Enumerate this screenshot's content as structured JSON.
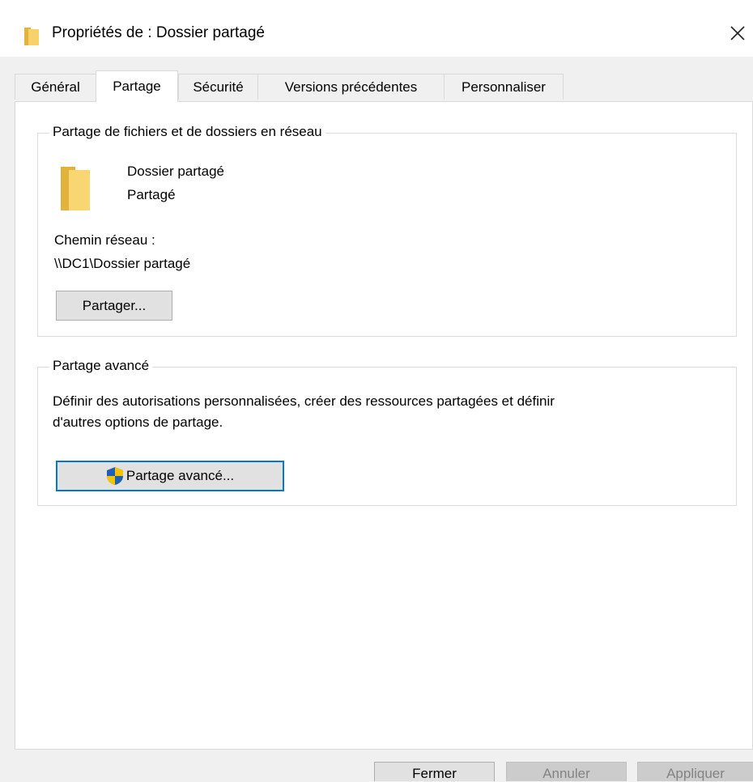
{
  "window": {
    "title": "Propriétés de : Dossier partagé",
    "close_glyph": "✕"
  },
  "tabs": [
    {
      "label": "Général",
      "active": false
    },
    {
      "label": "Partage",
      "active": true
    },
    {
      "label": "Sécurité",
      "active": false
    },
    {
      "label": "Versions précédentes",
      "active": false
    },
    {
      "label": "Personnaliser",
      "active": false
    }
  ],
  "network_sharing": {
    "legend": "Partage de fichiers et de dossiers en réseau",
    "folder_name": "Dossier partagé",
    "status": "Partagé",
    "path_label": "Chemin réseau :",
    "path_value": "\\\\DC1\\Dossier partagé",
    "share_button": "Partager..."
  },
  "advanced_sharing": {
    "legend": "Partage avancé",
    "description_line1": "Définir des autorisations personnalisées, créer des ressources partagées et définir",
    "description_line2": "d'autres options de partage.",
    "button": "Partage avancé..."
  },
  "footer": {
    "close": "Fermer",
    "cancel": "Annuler",
    "apply": "Appliquer"
  },
  "colors": {
    "accent": "#0078d7",
    "folder": "#f3c95f",
    "shield_blue": "#1f5fb7",
    "shield_yellow": "#f5c400"
  },
  "icons": {
    "title": "folder-icon",
    "folder": "folder-icon",
    "shield": "uac-shield-icon",
    "close": "close-icon"
  }
}
